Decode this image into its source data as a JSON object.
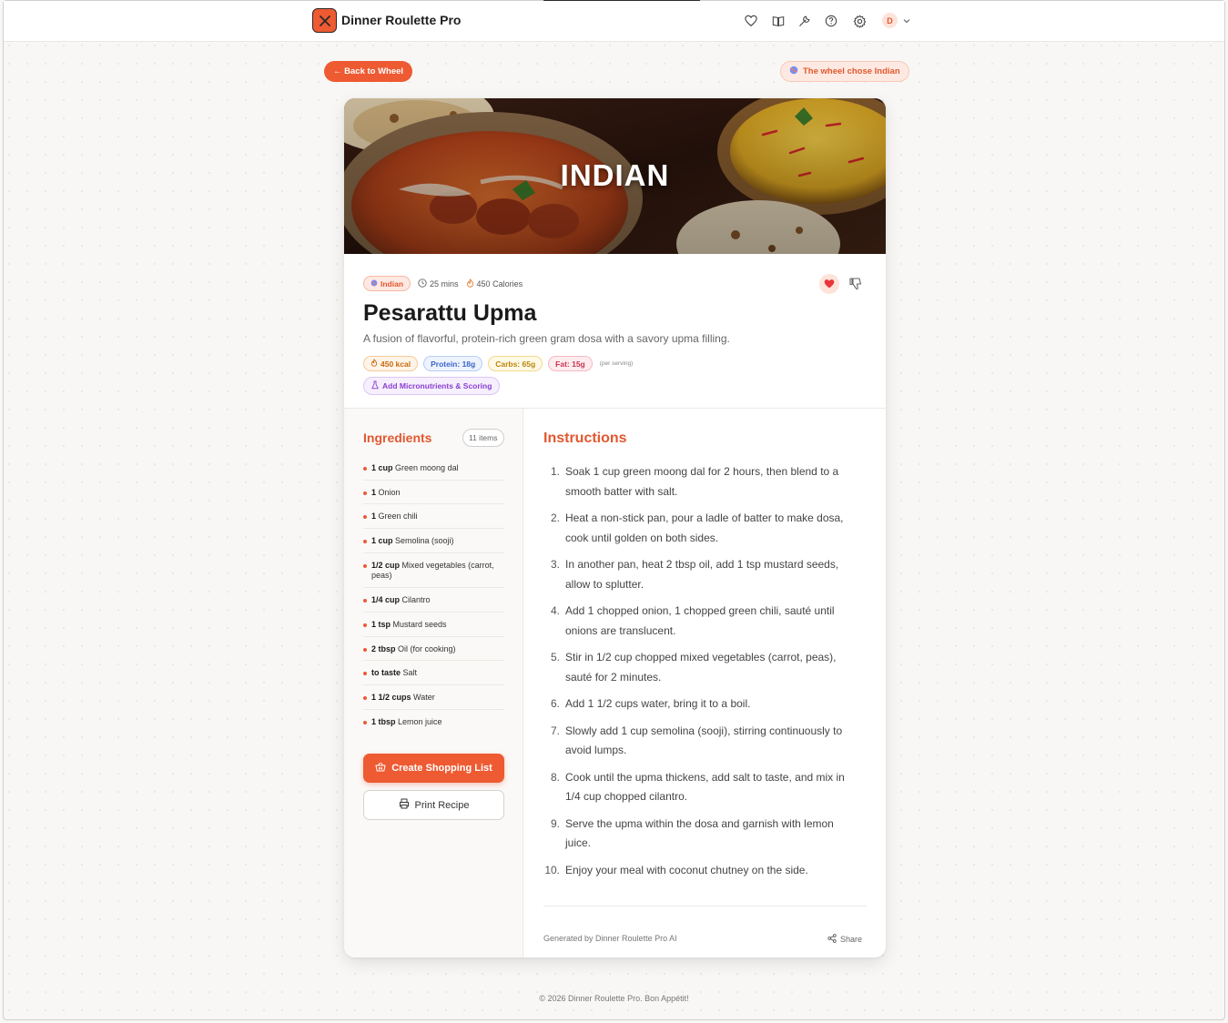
{
  "app": {
    "brand": "Dinner Roulette Pro",
    "avatar_initial": "D"
  },
  "nav": {
    "back_label": "← Back to Wheel",
    "chose_label": "The wheel chose Indian"
  },
  "hero": {
    "title": "INDIAN"
  },
  "recipe": {
    "cuisine_tag": "Indian",
    "time": "25 mins",
    "calories": "450 Calories",
    "title": "Pesarattu Upma",
    "description": "A fusion of flavorful, protein-rich green gram dosa with a savory upma filling.",
    "nutrition": {
      "kcal": "450 kcal",
      "protein": "Protein: 18g",
      "carbs": "Carbs: 65g",
      "fat": "Fat: 15g",
      "per": "(per serving)"
    },
    "micro_button": "Add Micronutrients & Scoring"
  },
  "ingredients": {
    "title": "Ingredients",
    "count": "11 items",
    "items": [
      {
        "qty": "1 cup",
        "name": "Green moong dal"
      },
      {
        "qty": "1",
        "name": "Onion"
      },
      {
        "qty": "1",
        "name": "Green chili"
      },
      {
        "qty": "1 cup",
        "name": "Semolina (sooji)"
      },
      {
        "qty": "1/2 cup",
        "name": "Mixed vegetables (carrot, peas)"
      },
      {
        "qty": "1/4 cup",
        "name": "Cilantro"
      },
      {
        "qty": "1 tsp",
        "name": "Mustard seeds"
      },
      {
        "qty": "2 tbsp",
        "name": "Oil (for cooking)"
      },
      {
        "qty": "to taste",
        "name": "Salt"
      },
      {
        "qty": "1 1/2 cups",
        "name": "Water"
      },
      {
        "qty": "1 tbsp",
        "name": "Lemon juice"
      }
    ],
    "shopping_button": "Create Shopping List",
    "print_button": "Print Recipe"
  },
  "instructions": {
    "title": "Instructions",
    "steps": [
      {
        "num": "1.",
        "text": "Soak 1 cup green moong dal for 2 hours, then blend to a smooth batter with salt."
      },
      {
        "num": "2.",
        "text": "Heat a non-stick pan, pour a ladle of batter to make dosa, cook until golden on both sides."
      },
      {
        "num": "3.",
        "text": "In another pan, heat 2 tbsp oil, add 1 tsp mustard seeds, allow to splutter."
      },
      {
        "num": "4.",
        "text": "Add 1 chopped onion, 1 chopped green chili, sauté until onions are translucent."
      },
      {
        "num": "5.",
        "text": "Stir in 1/2 cup chopped mixed vegetables (carrot, peas), sauté for 2 minutes."
      },
      {
        "num": "6.",
        "text": "Add 1 1/2 cups water, bring it to a boil."
      },
      {
        "num": "7.",
        "text": "Slowly add 1 cup semolina (sooji), stirring continuously to avoid lumps."
      },
      {
        "num": "8.",
        "text": "Cook until the upma thickens, add salt to taste, and mix in 1/4 cup chopped cilantro."
      },
      {
        "num": "9.",
        "text": "Serve the upma within the dosa and garnish with lemon juice."
      },
      {
        "num": "10.",
        "text": "Enjoy your meal with coconut chutney on the side."
      }
    ],
    "generated_by": "Generated by Dinner Roulette Pro AI",
    "share_label": "Share"
  },
  "footer": {
    "copyright": "© 2026 Dinner Roulette Pro. Bon Appétit!"
  },
  "colors": {
    "accent": "#ee5a32",
    "accent_text": "#e2572f",
    "background": "#f8f7f5"
  }
}
